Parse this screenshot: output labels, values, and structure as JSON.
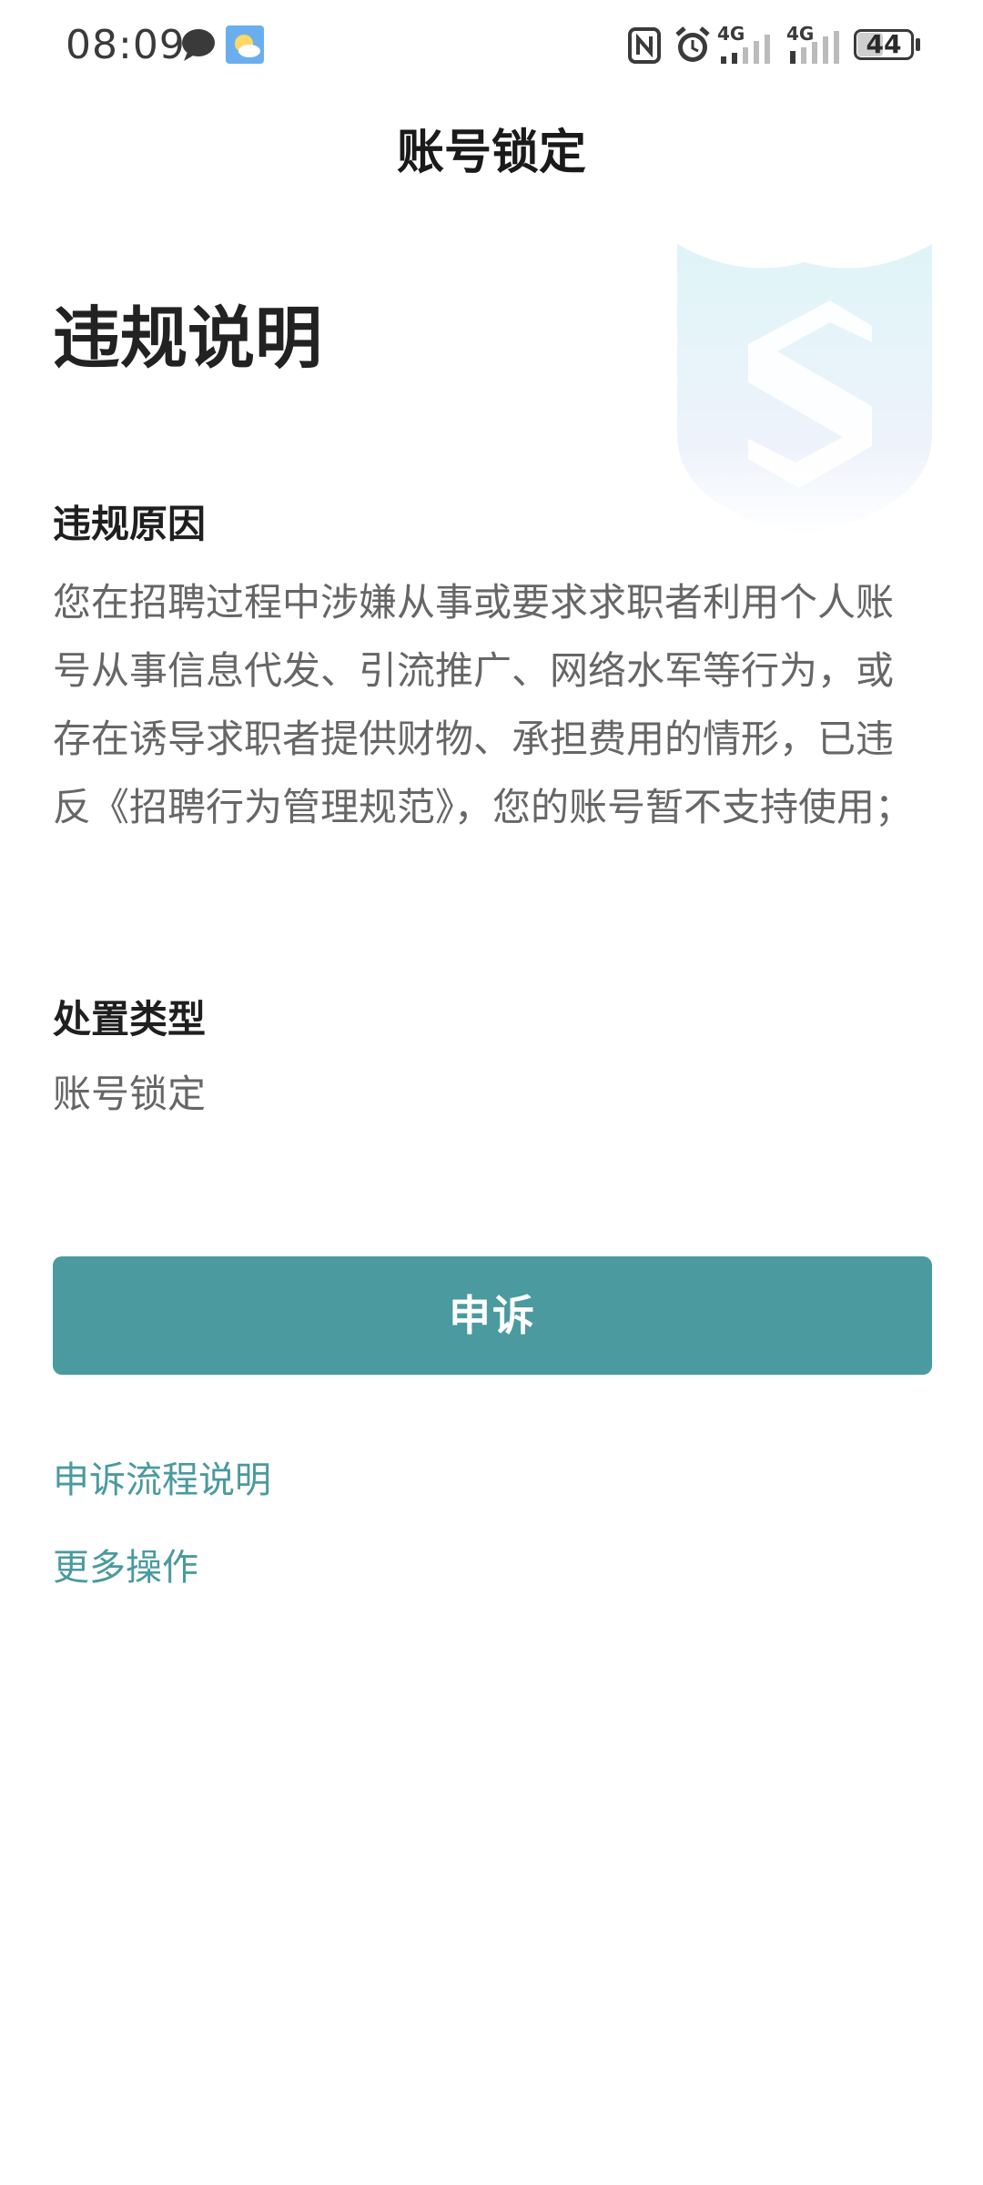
{
  "status_bar": {
    "time": "08:09",
    "network_1": "4G",
    "network_2": "4G",
    "battery": "44",
    "icons": [
      "chat-bubble-icon",
      "weather-icon",
      "nfc-icon",
      "alarm-icon",
      "signal-icon",
      "signal-icon",
      "battery-icon"
    ]
  },
  "header": {
    "title": "账号锁定"
  },
  "main": {
    "heading": "违规说明",
    "reason_label": "违规原因",
    "reason_text": "您在招聘过程中涉嫌从事或要求求职者利用个人账号从事信息代发、引流推广、网络水军等行为，或存在诱导求职者提供财物、承担费用的情形，已违反《招聘行为管理规范》，您的账号暂不支持使用；",
    "type_label": "处置类型",
    "type_value": "账号锁定",
    "watermark_icon": "shield-icon"
  },
  "actions": {
    "appeal_button": "申诉",
    "appeal_process_link": "申诉流程说明",
    "more_actions_link": "更多操作"
  },
  "colors": {
    "accent": "#4a9a9f",
    "body_text": "#666666",
    "heading_text": "#222222"
  }
}
